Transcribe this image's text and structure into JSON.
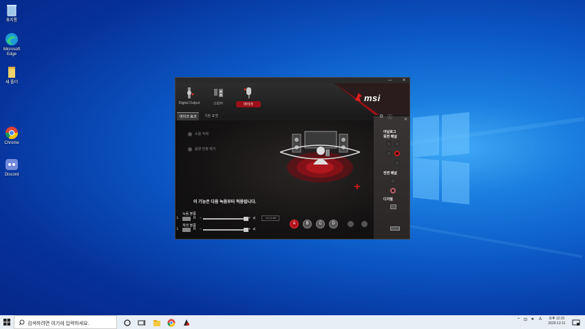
{
  "desktop": {
    "icons": [
      {
        "name": "recycle-bin",
        "label": "휴지통"
      },
      {
        "name": "edge",
        "label": "Microsoft Edge"
      },
      {
        "name": "folder",
        "label": "새 폴더"
      },
      {
        "name": "chrome",
        "label": "Chrome"
      },
      {
        "name": "discord",
        "label": "Discord"
      }
    ]
  },
  "app": {
    "title_controls": {
      "minimize": "—",
      "close": "✕"
    },
    "devices": [
      {
        "label": "Digital Output"
      },
      {
        "label": "스피커"
      },
      {
        "label": "마이크"
      }
    ],
    "brand": "msi",
    "tabs": [
      {
        "label": "마이크 효과"
      },
      {
        "label": "기본 포맷"
      }
    ],
    "options": [
      {
        "label": "소음 억제"
      },
      {
        "label": "음향 반향 제거"
      }
    ],
    "note": "이 기능은 다음 녹음부터 적용됩니다.",
    "side": {
      "analog_label": "아날로그",
      "rear_label": "뒷면 패널",
      "front_label": "전면 패널",
      "digital_label": "디지털"
    },
    "volume": {
      "record_label": "녹음 볼륨",
      "playback_label": "재생 볼륨",
      "left": "L",
      "right": "R",
      "minus": "−",
      "plus": "+",
      "db_value": "+10.0 dB"
    },
    "presets": [
      "A",
      "B",
      "C",
      "D"
    ]
  },
  "taskbar": {
    "search_placeholder": "검색하려면 여기에 입력하세요.",
    "tray_lang": "A",
    "time": "오후 12:31",
    "date": "2020-12-11"
  },
  "colors": {
    "accent_red": "#b0121c",
    "desktop_blue": "#0b57c4"
  }
}
